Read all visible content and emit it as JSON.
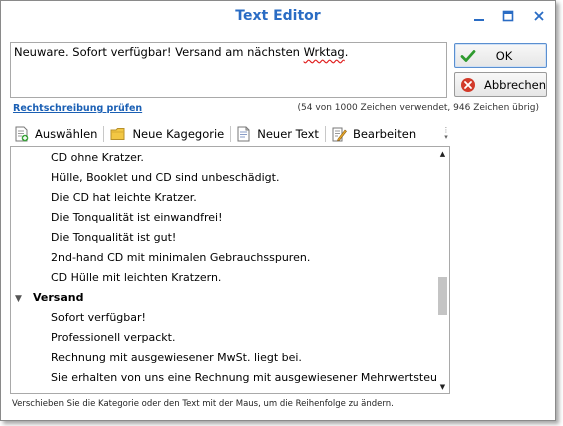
{
  "window": {
    "title": "Text Editor"
  },
  "editor": {
    "text_before": "Neuware. Sofort verfügbar! Versand am nächsten ",
    "text_misspelled": "Wrktag",
    "text_after": "."
  },
  "buttons": {
    "ok": "OK",
    "cancel": "Abbrechen"
  },
  "spellcheck_link": "Rechtschreibung prüfen",
  "char_count": "(54 von 1000 Zeichen verwendet, 946 Zeichen übrig)",
  "toolbar": {
    "select": "Auswählen",
    "new_category": "Neue Kagegorie",
    "new_text": "Neuer Text",
    "edit": "Bearbeiten"
  },
  "list": {
    "items": [
      {
        "type": "item",
        "text": "CD ohne Kratzer."
      },
      {
        "type": "item",
        "text": "Hülle, Booklet und CD sind unbeschädigt."
      },
      {
        "type": "item",
        "text": "Die CD hat leichte Kratzer."
      },
      {
        "type": "item",
        "text": "Die Tonqualität ist einwandfrei!"
      },
      {
        "type": "item",
        "text": "Die Tonqualität ist gut!"
      },
      {
        "type": "item",
        "text": "2nd-hand CD mit minimalen Gebrauchsspuren."
      },
      {
        "type": "item",
        "text": "CD Hülle mit leichten Kratzern."
      },
      {
        "type": "category",
        "text": "Versand"
      },
      {
        "type": "item",
        "text": "Sofort verfügbar!"
      },
      {
        "type": "item",
        "text": "Professionell verpackt."
      },
      {
        "type": "item",
        "text": "Rechnung mit ausgewiesener MwSt. liegt bei."
      },
      {
        "type": "item",
        "text": "Sie erhalten von uns eine Rechnung mit ausgewiesener Mehrwertsteuer."
      }
    ]
  },
  "hint": "Verschieben Sie die Kategorie oder den Text mit der Maus, um die Reihenfolge zu ändern.",
  "colors": {
    "title": "#2a6cc4",
    "link": "#1a5fb4",
    "ok_check": "#2e9a2e",
    "cancel_x": "#d23a2a"
  }
}
